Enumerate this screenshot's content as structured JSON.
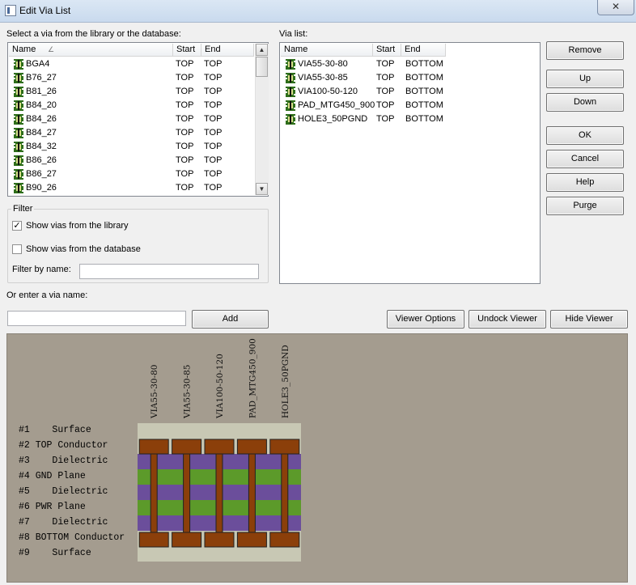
{
  "window": {
    "title": "Edit Via List",
    "close_glyph": "✕"
  },
  "library": {
    "label": "Select a via from the library or the database:",
    "columns": [
      "Name",
      "Start",
      "End"
    ],
    "sort_glyph": "∠",
    "rows": [
      {
        "name": "BGA4",
        "start": "TOP",
        "end": "TOP"
      },
      {
        "name": "B76_27",
        "start": "TOP",
        "end": "TOP"
      },
      {
        "name": "B81_26",
        "start": "TOP",
        "end": "TOP"
      },
      {
        "name": "B84_20",
        "start": "TOP",
        "end": "TOP"
      },
      {
        "name": "B84_26",
        "start": "TOP",
        "end": "TOP"
      },
      {
        "name": "B84_27",
        "start": "TOP",
        "end": "TOP"
      },
      {
        "name": "B84_32",
        "start": "TOP",
        "end": "TOP"
      },
      {
        "name": "B86_26",
        "start": "TOP",
        "end": "TOP"
      },
      {
        "name": "B86_27",
        "start": "TOP",
        "end": "TOP"
      },
      {
        "name": "B90_26",
        "start": "TOP",
        "end": "TOP"
      }
    ]
  },
  "via_list": {
    "label": "Via list:",
    "columns": [
      "Name",
      "Start",
      "End"
    ],
    "rows": [
      {
        "name": "VIA55-30-80",
        "start": "TOP",
        "end": "BOTTOM"
      },
      {
        "name": "VIA55-30-85",
        "start": "TOP",
        "end": "BOTTOM"
      },
      {
        "name": "VIA100-50-120",
        "start": "TOP",
        "end": "BOTTOM"
      },
      {
        "name": "PAD_MTG450_900",
        "start": "TOP",
        "end": "BOTTOM"
      },
      {
        "name": "HOLE3_50PGND",
        "start": "TOP",
        "end": "BOTTOM"
      }
    ]
  },
  "buttons": {
    "remove": "Remove",
    "up": "Up",
    "down": "Down",
    "ok": "OK",
    "cancel": "Cancel",
    "help": "Help",
    "purge": "Purge",
    "add": "Add",
    "viewer_options": "Viewer Options",
    "undock_viewer": "Undock Viewer",
    "hide_viewer": "Hide Viewer"
  },
  "filter": {
    "title": "Filter",
    "show_library": {
      "label": "Show vias from the library",
      "checked": true
    },
    "show_database": {
      "label": "Show vias from the database",
      "checked": false
    },
    "by_name_label": "Filter by name:",
    "by_name_value": ""
  },
  "enter_via": {
    "label": "Or enter a via name:",
    "value": ""
  },
  "viewer": {
    "via_names": [
      "VIA55-30-80",
      "VIA55-30-85",
      "VIA100-50-120",
      "PAD_MTG450_900",
      "HOLE3_50PGND"
    ],
    "layers": [
      {
        "num": "#1",
        "name": "   Surface"
      },
      {
        "num": "#2",
        "name": "TOP Conductor"
      },
      {
        "num": "#3",
        "name": "   Dielectric"
      },
      {
        "num": "#4",
        "name": "GND Plane"
      },
      {
        "num": "#5",
        "name": "   Dielectric"
      },
      {
        "num": "#6",
        "name": "PWR Plane"
      },
      {
        "num": "#7",
        "name": "   Dielectric"
      },
      {
        "num": "#8",
        "name": "BOTTOM Conductor"
      },
      {
        "num": "#9",
        "name": "   Surface"
      }
    ],
    "colors": {
      "surface": "#c8c8b4",
      "conductor": "#8b3f0a",
      "dielectric": "#6b4e9b",
      "plane": "#5c9a2a",
      "background": "#a49c8f"
    }
  }
}
